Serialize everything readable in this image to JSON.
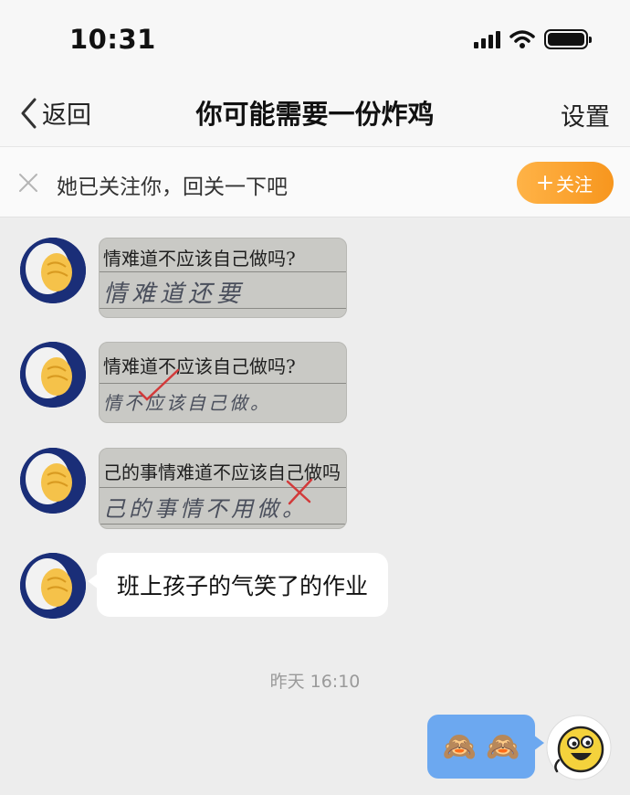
{
  "status_bar": {
    "time": "10:31"
  },
  "nav": {
    "back_label": "返回",
    "title": "你可能需要一份炸鸡",
    "settings_label": "设置"
  },
  "banner": {
    "text": "她已关注你，回关一下吧",
    "follow_label": "关注",
    "follow_icon": "plus-icon",
    "close_icon": "close-icon"
  },
  "messages": [
    {
      "type": "image",
      "printed": "情难道不应该自己做吗?",
      "handwriting": "情难道还要"
    },
    {
      "type": "image",
      "printed": "情难道不应该自己做吗?",
      "handwriting": "情不应该自己做。"
    },
    {
      "type": "image",
      "printed": "己的事情难道不应该自己做吗",
      "handwriting": "己的事情不用做。"
    },
    {
      "type": "text",
      "text": "班上孩子的气笑了的作业"
    }
  ],
  "timestamp": "昨天 16:10",
  "my_message": {
    "emojis": [
      "🙈",
      "🙈"
    ]
  },
  "colors": {
    "follow_button": "#f7961e",
    "my_bubble": "#6ca8f0",
    "avatar_bg": "#1a2e78"
  }
}
